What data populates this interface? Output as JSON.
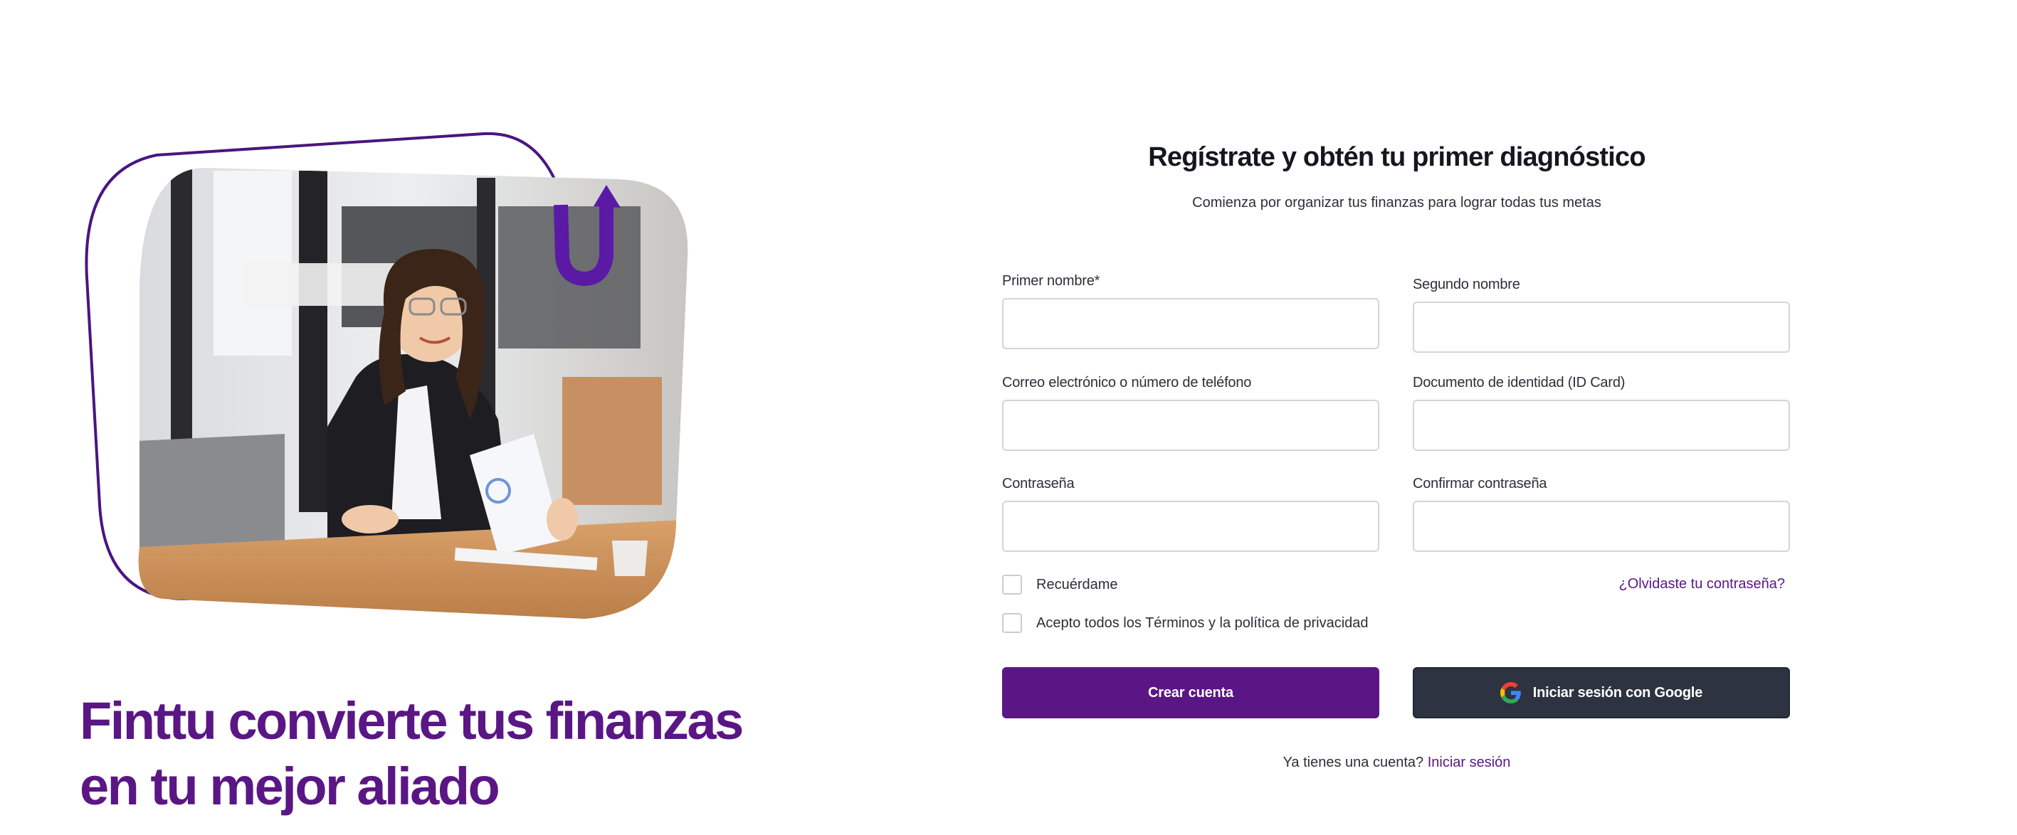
{
  "hero": {
    "headline_line1": "Finttu convierte tus finanzas",
    "headline_line2": "en tu mejor aliado",
    "accent_color": "#5a1685",
    "illustration_icon": "finttu-up-arrow-logo-icon"
  },
  "form": {
    "title": "Regístrate y obtén tu primer diagnóstico",
    "subtitle": "Comienza por organizar tus finanzas para lograr todas tus metas",
    "fields": {
      "first_name": {
        "label": "Primer nombre*",
        "value": "",
        "placeholder": ""
      },
      "second_name": {
        "label": "Segundo nombre",
        "value": "",
        "placeholder": ""
      },
      "email_phone": {
        "label": "Correo electrónico o número de teléfono",
        "value": "",
        "placeholder": ""
      },
      "id_document": {
        "label": "Documento de identidad (ID Card)",
        "value": "",
        "placeholder": ""
      },
      "password": {
        "label": "Contraseña",
        "value": "",
        "placeholder": ""
      },
      "confirm_password": {
        "label": "Confirmar contraseña",
        "value": "",
        "placeholder": ""
      }
    },
    "remember_me": {
      "label": "Recuérdame",
      "checked": false
    },
    "accept_terms": {
      "label": "Acepto todos los Términos y la política de privacidad",
      "checked": false
    },
    "forgot_password": "¿Olvidaste tu contraseña?",
    "create_account_button": "Crear cuenta",
    "google_button": "Iniciar sesión con Google",
    "google_icon": "google-g-icon",
    "have_account_text": "Ya tienes una cuenta?",
    "login_link": "Iniciar sesión"
  },
  "colors": {
    "primary_purple": "#5a1685",
    "google_button_bg": "#2d3340",
    "input_border": "#d3d5dc"
  }
}
